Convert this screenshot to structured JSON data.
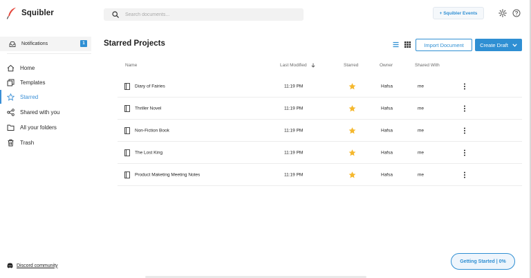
{
  "app": {
    "name": "Squibler"
  },
  "search": {
    "placeholder": "Search documents..."
  },
  "header": {
    "events_label": "+ Squibler Events"
  },
  "sidebar": {
    "notifications": {
      "label": "Notifications",
      "count": "1"
    },
    "items": [
      {
        "label": "Home",
        "icon": "home-icon"
      },
      {
        "label": "Templates",
        "icon": "templates-icon"
      },
      {
        "label": "Starred",
        "icon": "star-icon",
        "active": true
      },
      {
        "label": "Shared with you",
        "icon": "share-icon"
      },
      {
        "label": "All your folders",
        "icon": "folder-icon"
      },
      {
        "label": "Trash",
        "icon": "trash-icon"
      }
    ],
    "discord_label": "Discord community"
  },
  "main": {
    "title": "Starred Projects",
    "import_label": "Import Document",
    "create_label": "Create Draft",
    "columns": {
      "name": "Name",
      "modified": "Last Modified",
      "starred": "Starred",
      "owner": "Owner",
      "shared": "Shared With"
    },
    "rows": [
      {
        "name": "Diary of Fairies",
        "modified": "11:19 PM",
        "owner": "Hafsa",
        "shared": "me"
      },
      {
        "name": "Thriller Novel",
        "modified": "11:19 PM",
        "owner": "Hafsa",
        "shared": "me"
      },
      {
        "name": "Non-Fiction Book",
        "modified": "11:19 PM",
        "owner": "Hafsa",
        "shared": "me"
      },
      {
        "name": "The Lost King",
        "modified": "11:19 PM",
        "owner": "Hafsa",
        "shared": "me"
      },
      {
        "name": "Product Maketing Meeting Notes",
        "modified": "11:19 PM",
        "owner": "Hafsa",
        "shared": "me"
      }
    ]
  },
  "getting_started": {
    "label": "Getting Started | 0%"
  },
  "colors": {
    "accent": "#2f8fd3",
    "star": "#f5b82e",
    "text": "#222222"
  }
}
